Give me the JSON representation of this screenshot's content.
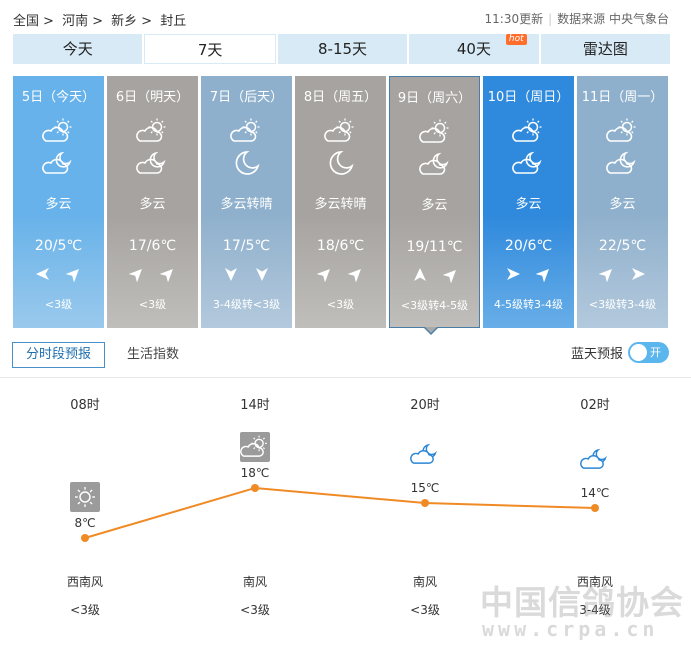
{
  "breadcrumb": {
    "items": [
      "全国",
      "河南",
      "新乡",
      "封丘"
    ],
    "separator": ">"
  },
  "source": {
    "updated": "11:30更新",
    "label": "数据来源",
    "provider": "中央气象台"
  },
  "tabs": [
    {
      "label": "今天",
      "active": false
    },
    {
      "label": "7天",
      "active": true
    },
    {
      "label": "8-15天",
      "active": false
    },
    {
      "label": "40天",
      "active": false,
      "badge": "hot"
    },
    {
      "label": "雷达图",
      "active": false
    }
  ],
  "days": [
    {
      "date": "5日（今天）",
      "icon_day": "partly-cloudy-day-icon",
      "icon_night": "partly-cloudy-night-icon",
      "condition": "多云",
      "temp": "20/5℃",
      "wind_arrows": [
        "wind-arrow-west",
        "wind-arrow-northeast"
      ],
      "wind": "<3级",
      "bg": "#67b2ea",
      "bg2": "#9ac9ec"
    },
    {
      "date": "6日（明天）",
      "icon_day": "partly-cloudy-day-icon",
      "icon_night": "partly-cloudy-night-icon",
      "condition": "多云",
      "temp": "17/6℃",
      "wind_arrows": [
        "wind-arrow-northeast",
        "wind-arrow-northeast"
      ],
      "wind": "<3级",
      "bg": "#a6a3a0",
      "bg2": "#c0bebb"
    },
    {
      "date": "7日（后天）",
      "icon_day": "partly-cloudy-day-icon",
      "icon_night": "moon-icon",
      "condition": "多云转晴",
      "temp": "17/5℃",
      "wind_arrows": [
        "wind-arrow-south",
        "wind-arrow-south"
      ],
      "wind": "3-4级转<3级",
      "bg": "#8fb0cc",
      "bg2": "#b3c9dd"
    },
    {
      "date": "8日（周五）",
      "icon_day": "partly-cloudy-day-icon",
      "icon_night": "moon-icon",
      "condition": "多云转晴",
      "temp": "18/6℃",
      "wind_arrows": [
        "wind-arrow-northeast",
        "wind-arrow-northeast"
      ],
      "wind": "<3级",
      "bg": "#a6a3a0",
      "bg2": "#c0bebb"
    },
    {
      "date": "9日（周六）",
      "icon_day": "partly-cloudy-day-icon",
      "icon_night": "partly-cloudy-night-icon",
      "condition": "多云",
      "temp": "19/11℃",
      "wind_arrows": [
        "wind-arrow-north",
        "wind-arrow-northeast"
      ],
      "wind": "<3级转4-5级",
      "bg": "#a6a3a0",
      "bg2": "#c0bebb"
    },
    {
      "date": "10日（周日）",
      "icon_day": "partly-cloudy-day-icon",
      "icon_night": "partly-cloudy-night-icon",
      "condition": "多云",
      "temp": "20/6℃",
      "wind_arrows": [
        "wind-arrow-east",
        "wind-arrow-northeast"
      ],
      "wind": "4-5级转3-4级",
      "bg": "#2f89dc",
      "bg2": "#68aee8"
    },
    {
      "date": "11日（周一）",
      "icon_day": "partly-cloudy-day-icon",
      "icon_night": "partly-cloudy-night-icon",
      "condition": "多云",
      "temp": "22/5℃",
      "wind_arrows": [
        "wind-arrow-northeast",
        "wind-arrow-east"
      ],
      "wind": "<3级转3-4级",
      "bg": "#8fb0cc",
      "bg2": "#b3c9dd"
    }
  ],
  "selected_day_index": 4,
  "subtabs": {
    "hourly": "分时段预报",
    "life": "生活指数"
  },
  "blue_sky": {
    "label": "蓝天预报",
    "toggle": "开",
    "on": true
  },
  "hourly": [
    {
      "time": "08时",
      "icon": "sunny-icon",
      "temp": "8℃",
      "temp_value": 8,
      "wind_dir": "西南风",
      "wind_level": "<3级"
    },
    {
      "time": "14时",
      "icon": "partly-cloudy-day-icon",
      "temp": "18℃",
      "temp_value": 18,
      "wind_dir": "南风",
      "wind_level": "<3级"
    },
    {
      "time": "20时",
      "icon": "partly-cloudy-night-icon",
      "temp": "15℃",
      "temp_value": 15,
      "wind_dir": "南风",
      "wind_level": "<3级"
    },
    {
      "time": "02时",
      "icon": "partly-cloudy-night-icon",
      "temp": "14℃",
      "temp_value": 14,
      "wind_dir": "西南风",
      "wind_level": "3-4级"
    }
  ],
  "colors": {
    "line": "#f08a24",
    "tab_bg": "#d8eaf6",
    "accent": "#1e6fb0"
  },
  "watermark": {
    "cn": "中国信鸽协会",
    "url": "www.crpa.cn"
  }
}
